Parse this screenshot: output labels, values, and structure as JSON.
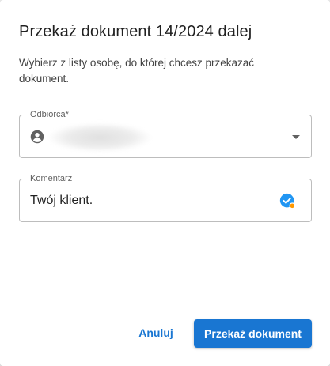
{
  "dialog": {
    "title": "Przekaż dokument 14/2024 dalej",
    "description": "Wybierz z listy osobę, do której chcesz przekazać dokument."
  },
  "recipient_field": {
    "label": "Odbiorca*",
    "icon": "person-icon",
    "dropdown_icon": "chevron-down-icon"
  },
  "comment_field": {
    "label": "Komentarz",
    "value": "Twój klient.",
    "icon": "check-circle-icon"
  },
  "actions": {
    "cancel_label": "Anuluj",
    "submit_label": "Przekaż dokument"
  },
  "colors": {
    "accent": "#1976d2",
    "check_blue": "#2196f3",
    "status_dot": "#ff9800"
  }
}
